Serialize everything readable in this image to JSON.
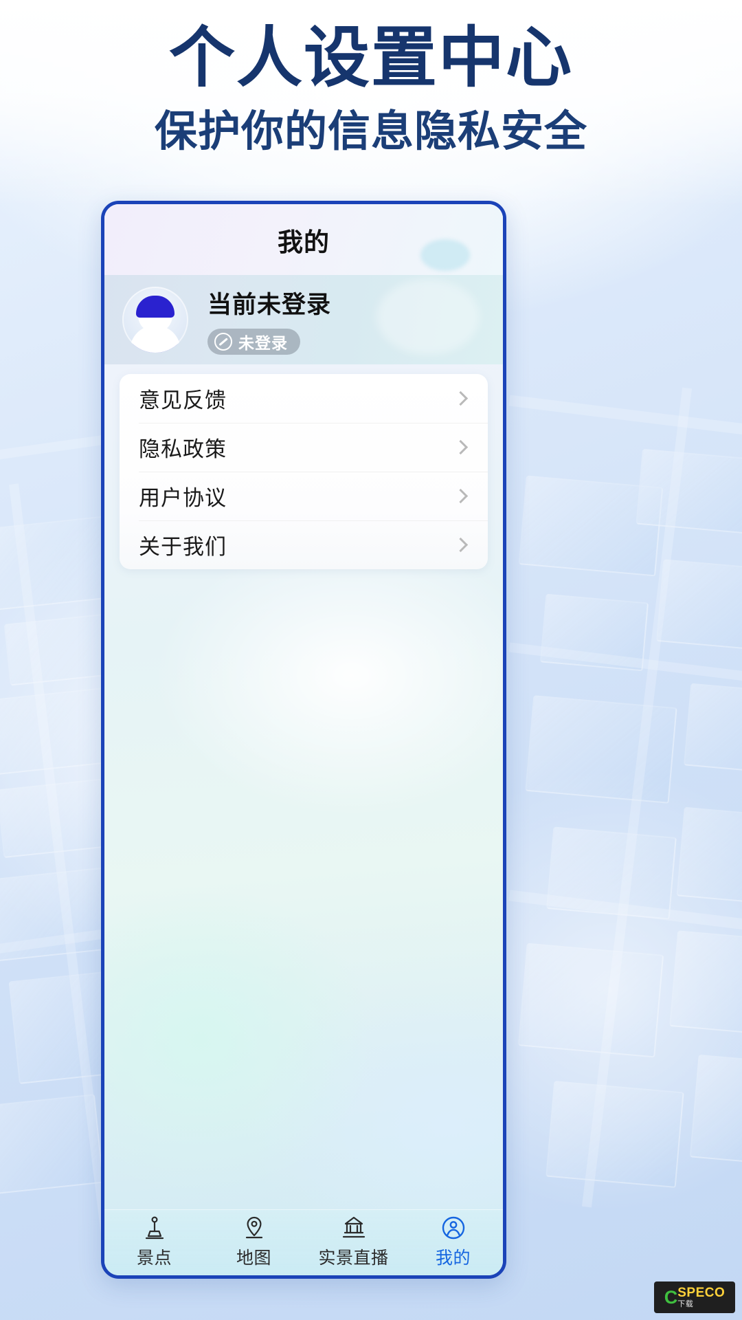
{
  "page": {
    "title": "个人设置中心",
    "subtitle": "保护你的信息隐私安全",
    "title_color": "#16356d"
  },
  "phone": {
    "app_header": {
      "title": "我的"
    },
    "profile": {
      "username": "当前未登录",
      "badge_text": "未登录",
      "badge_icon": "no-entry-circle-icon",
      "avatar_icon": "default-user-avatar"
    },
    "menu": {
      "items": [
        {
          "label": "意见反馈",
          "chevron": "chevron-right-icon"
        },
        {
          "label": "隐私政策",
          "chevron": "chevron-right-icon"
        },
        {
          "label": "用户协议",
          "chevron": "chevron-right-icon"
        },
        {
          "label": "关于我们",
          "chevron": "chevron-right-icon"
        }
      ]
    },
    "tabbar": {
      "active_color": "#1565e0",
      "inactive_color": "#2b2b2b",
      "tabs": [
        {
          "label": "景点",
          "icon": "attraction-pin-icon",
          "active": false
        },
        {
          "label": "地图",
          "icon": "map-location-icon",
          "active": false
        },
        {
          "label": "实景直播",
          "icon": "pavilion-live-icon",
          "active": false
        },
        {
          "label": "我的",
          "icon": "profile-circle-icon",
          "active": true
        }
      ]
    }
  },
  "watermark": {
    "mark": "C",
    "brand": "SPECO",
    "suffix": "下载"
  }
}
